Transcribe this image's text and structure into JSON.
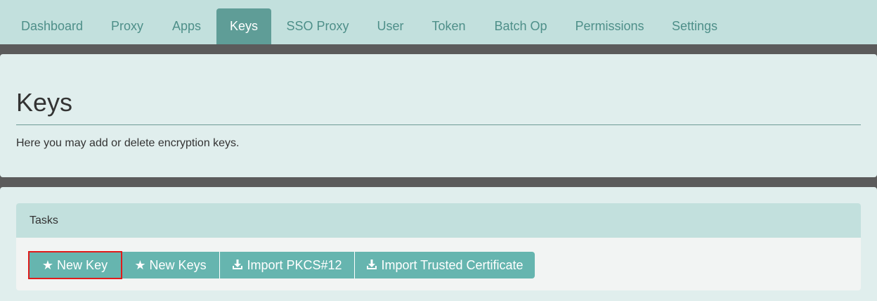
{
  "nav": {
    "tabs": [
      {
        "label": "Dashboard",
        "active": false
      },
      {
        "label": "Proxy",
        "active": false
      },
      {
        "label": "Apps",
        "active": false
      },
      {
        "label": "Keys",
        "active": true
      },
      {
        "label": "SSO Proxy",
        "active": false
      },
      {
        "label": "User",
        "active": false
      },
      {
        "label": "Token",
        "active": false
      },
      {
        "label": "Batch Op",
        "active": false
      },
      {
        "label": "Permissions",
        "active": false
      },
      {
        "label": "Settings",
        "active": false
      }
    ]
  },
  "page": {
    "title": "Keys",
    "description": "Here you may add or delete encryption keys."
  },
  "tasks": {
    "heading": "Tasks",
    "buttons": [
      {
        "label": "New Key",
        "icon": "star-icon"
      },
      {
        "label": "New Keys",
        "icon": "star-icon"
      },
      {
        "label": "Import PKCS#12",
        "icon": "import-icon"
      },
      {
        "label": "Import Trusted Certificate",
        "icon": "import-icon"
      }
    ]
  },
  "colors": {
    "accent": "#5f9d97",
    "button": "#66b5af",
    "nav_bg": "#c2e0dd",
    "highlight": "#e01a1a"
  }
}
